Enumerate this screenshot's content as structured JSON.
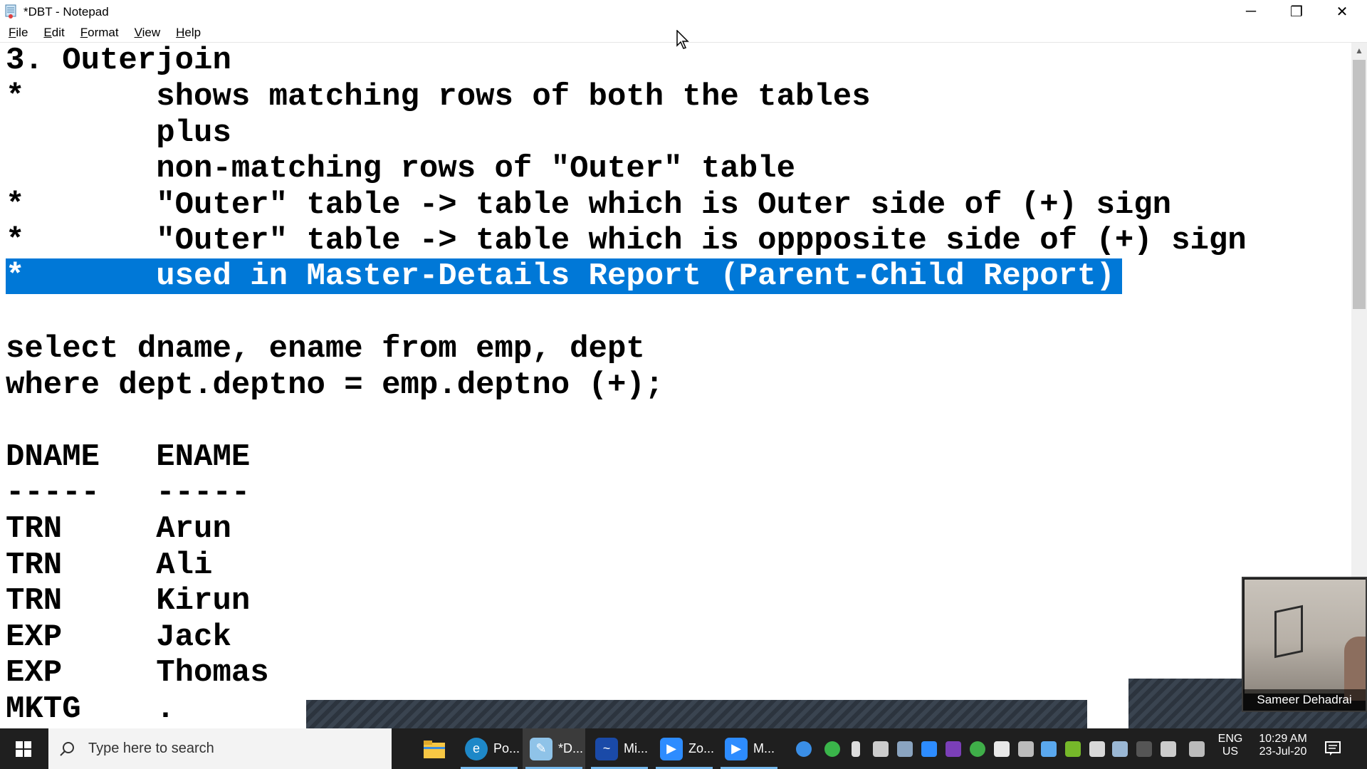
{
  "window": {
    "title": "*DBT - Notepad",
    "minimize_glyph": "─",
    "maximize_glyph": "❐",
    "close_glyph": "✕"
  },
  "menu": {
    "items": [
      {
        "label": "File"
      },
      {
        "label": "Edit"
      },
      {
        "label": "Format"
      },
      {
        "label": "View"
      },
      {
        "label": "Help"
      }
    ]
  },
  "editor": {
    "selection_color": "#0078d7",
    "lines": [
      "3. Outerjoin",
      "*       shows matching rows of both the tables",
      "        plus",
      "        non-matching rows of \"Outer\" table",
      "*       \"Outer\" table -> table which is Outer side of (+) sign",
      "*       \"Outer\" table -> table which is oppposite side of (+) sign",
      "*       used in Master-Details Report (Parent-Child Report)",
      "",
      "select dname, ename from emp, dept",
      "where dept.deptno = emp.deptno (+);",
      "",
      "DNAME   ENAME",
      "-----   -----",
      "TRN     Arun",
      "TRN     Ali",
      "TRN     Kirun",
      "EXP     Jack",
      "EXP     Thomas",
      "MKTG    ."
    ]
  },
  "video": {
    "participant_name": "Sameer Dehadrai"
  },
  "taskbar": {
    "search_placeholder": "Type here to search",
    "apps": [
      {
        "label": "Po...",
        "icon": "edge-icon"
      },
      {
        "label": "*D...",
        "icon": "notepad-icon"
      },
      {
        "label": "Mi...",
        "icon": "whiteboard-icon"
      },
      {
        "label": "Zo...",
        "icon": "zoom-icon"
      },
      {
        "label": "M...",
        "icon": "zoom-meeting-icon"
      }
    ],
    "language_line1": "ENG",
    "language_line2": "US",
    "time": "10:29 AM",
    "date": "23-Jul-20"
  }
}
